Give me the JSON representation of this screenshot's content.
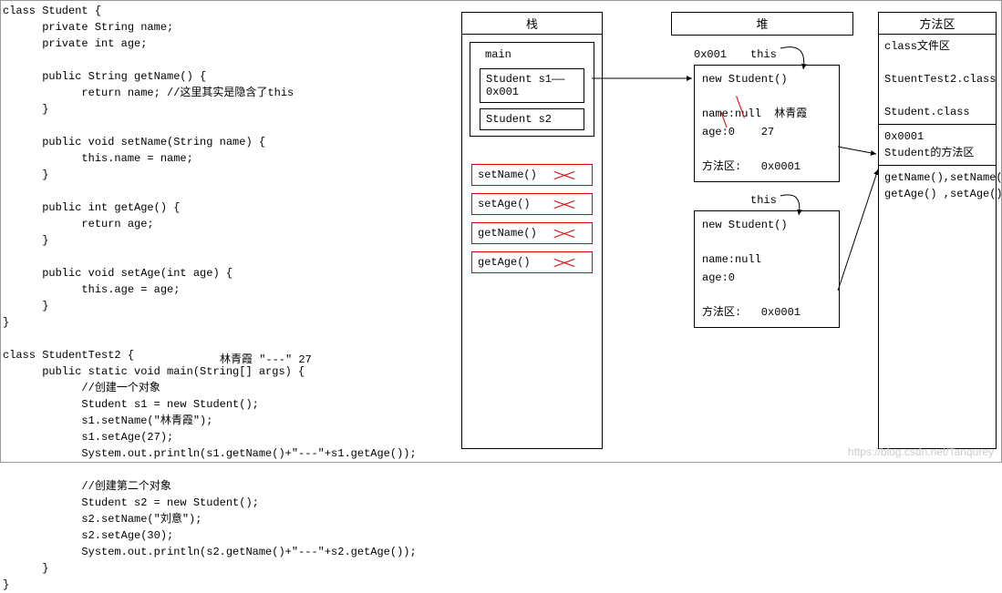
{
  "code": "class Student {\n      private String name;\n      private int age;\n\n      public String getName() {\n            return name; //这里其实是隐含了this\n      }\n\n      public void setName(String name) {\n            this.name = name;\n      }\n\n      public int getAge() {\n            return age;\n      }\n\n      public void setAge(int age) {\n            this.age = age;\n      }\n}\n\nclass StudentTest2 {\n      public static void main(String[] args) {\n            //创建一个对象\n            Student s1 = new Student();\n            s1.setName(\"林青霞\");\n            s1.setAge(27);\n            System.out.println(s1.getName()+\"---\"+s1.getAge());\n\n            //创建第二个对象\n            Student s2 = new Student();\n            s2.setName(\"刘意\");\n            s2.setAge(30);\n            System.out.println(s2.getName()+\"---\"+s2.getAge());\n      }\n}",
  "output_annot": "林青霞   \"---\"   27",
  "stack": {
    "title": "栈",
    "main_label": "main",
    "s1": "Student s1——0x001",
    "s2": "Student s2",
    "calls": [
      "setName()",
      "setAge()",
      "getName()",
      "getAge()"
    ]
  },
  "heap": {
    "title": "堆",
    "addr1": "0x001",
    "this1": "this",
    "obj1": "new Student()\n\nname:null  林青霞\nage:0    27\n\n方法区:   0x0001",
    "this2": "this",
    "obj2": "new Student()\n\nname:null\nage:0\n\n方法区:   0x0001"
  },
  "method_area": {
    "title": "方法区",
    "sec1": "class文件区\n\nStuentTest2.class\n\nStudent.class",
    "sec2": "0x0001\nStudent的方法区",
    "sec3": "getName(),setName()\ngetAge() ,setAge()"
  },
  "watermark": "https://blog.csdn.net/Tanqurey"
}
